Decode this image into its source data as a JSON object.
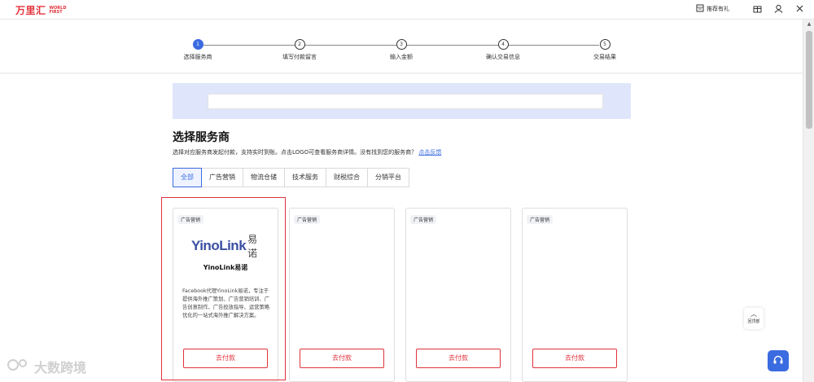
{
  "app": {
    "logo_cn": "万里汇",
    "logo_en": "WORLD FIRST",
    "top_links": {
      "gift": "推荐有礼"
    }
  },
  "steps": [
    {
      "num": "1",
      "label": "选择服务商"
    },
    {
      "num": "2",
      "label": "填写付款留言"
    },
    {
      "num": "3",
      "label": "输入金额"
    },
    {
      "num": "4",
      "label": "确认交易信息"
    },
    {
      "num": "5",
      "label": "交易结果"
    }
  ],
  "page": {
    "title": "选择服务商",
    "subtitle": "选择对应服务商发起付款，支持实时到账。点击LOGO可查看服务商详情。没有找到您的服务商？",
    "feedback_link": "点击反馈"
  },
  "tabs": [
    "全部",
    "广告营销",
    "物流仓储",
    "技术服务",
    "财税综合",
    "分销平台"
  ],
  "cards": [
    {
      "tag": "广告营销",
      "logo_text": "YinoLink",
      "logo_cn": "易诺",
      "name": "YinoLink易诺",
      "desc": "Facebook代理YinoLink易诺，专注于提供海外推广策划、广告营销培训、广告创意制作、广告投放指导、运营策略优化的一站式海外推广解决方案。",
      "pay_label": "去付款"
    },
    {
      "tag": "广告营销",
      "pay_label": "去付款"
    },
    {
      "tag": "广告营销",
      "pay_label": "去付款"
    },
    {
      "tag": "广告营销",
      "pay_label": "去付款"
    }
  ],
  "float": {
    "back_top": "回顶部"
  },
  "watermark": "大数跨境",
  "colors": {
    "accent": "#3b6be0",
    "brand_red": "#e1333b"
  }
}
